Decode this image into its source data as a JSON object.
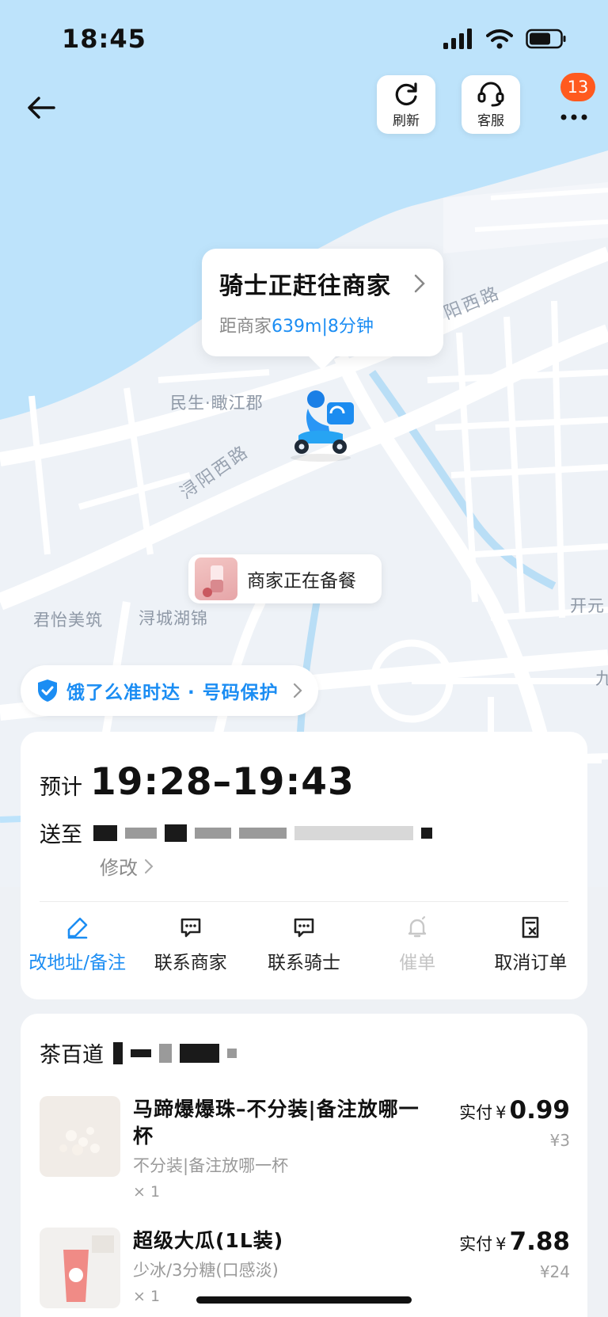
{
  "status_bar": {
    "time": "18:45"
  },
  "header": {
    "refresh_label": "刷新",
    "service_label": "客服",
    "message_badge": "13"
  },
  "map": {
    "labels": [
      "民生·瞰江郡",
      "君怡美筑",
      "浔城湖锦",
      "开元",
      "九"
    ],
    "roads": [
      "浔阳西路",
      "阳西路"
    ]
  },
  "rider_status": {
    "title": "骑士正赶往商家",
    "distance_prefix": "距商家",
    "distance": "639m",
    "separator": "|",
    "eta_minutes": "8分钟"
  },
  "merchant_status": "商家正在备餐",
  "guarantee": "饿了么准时达 · 号码保护",
  "delivery": {
    "eta_label": "预计",
    "eta_time": "19:28–19:43",
    "address_label": "送至",
    "modify_label": "修改",
    "actions": [
      {
        "label": "改地址/备注",
        "icon": "edit-icon",
        "state": "active"
      },
      {
        "label": "联系商家",
        "icon": "chat-icon",
        "state": "normal"
      },
      {
        "label": "联系骑士",
        "icon": "chat-icon",
        "state": "normal"
      },
      {
        "label": "催单",
        "icon": "bell-icon",
        "state": "disabled"
      },
      {
        "label": "取消订单",
        "icon": "cancel-order-icon",
        "state": "normal"
      }
    ]
  },
  "order": {
    "shop_name": "茶百道",
    "paid_label": "实付",
    "currency": "¥",
    "items": [
      {
        "name": "马蹄爆爆珠–不分装|备注放哪一杯",
        "spec": "不分装|备注放哪一杯",
        "qty": "× 1",
        "price": "0.99",
        "original": "¥3"
      },
      {
        "name": "超级大瓜(1L装)",
        "spec": "少冰/3分糖(口感淡)",
        "qty": "× 1",
        "price": "7.88",
        "original": "¥24"
      }
    ]
  },
  "colors": {
    "accent": "#1b8df3",
    "water": "#bde3fb",
    "badge": "#ff5a1f"
  }
}
